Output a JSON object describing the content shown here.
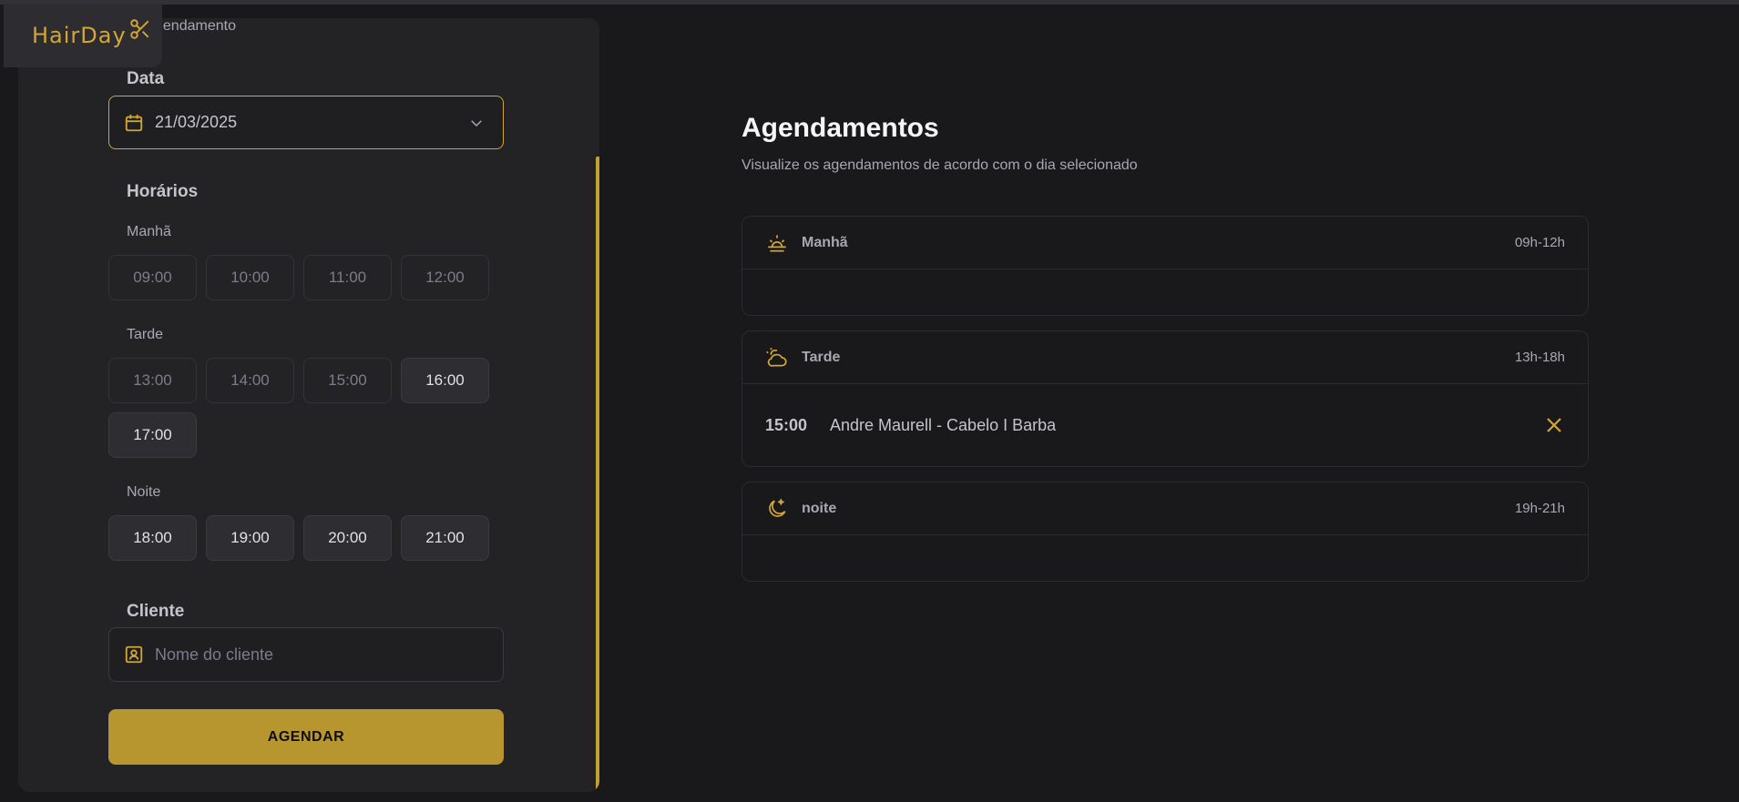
{
  "app": {
    "logo_text": "HairDay"
  },
  "form": {
    "subtitle_fragment": "gendamento",
    "date_label": "Data",
    "date_value": "21/03/2025",
    "times_label": "Horários",
    "groups": [
      {
        "label": "Manhã",
        "slots": [
          {
            "time": "09:00",
            "available": false
          },
          {
            "time": "10:00",
            "available": false
          },
          {
            "time": "11:00",
            "available": false
          },
          {
            "time": "12:00",
            "available": false
          }
        ]
      },
      {
        "label": "Tarde",
        "slots": [
          {
            "time": "13:00",
            "available": false
          },
          {
            "time": "14:00",
            "available": false
          },
          {
            "time": "15:00",
            "available": false
          },
          {
            "time": "16:00",
            "available": true
          },
          {
            "time": "17:00",
            "available": true
          }
        ]
      },
      {
        "label": "Noite",
        "slots": [
          {
            "time": "18:00",
            "available": true
          },
          {
            "time": "19:00",
            "available": true
          },
          {
            "time": "20:00",
            "available": true
          },
          {
            "time": "21:00",
            "available": true
          }
        ]
      }
    ],
    "client_label": "Cliente",
    "client_placeholder": "Nome do cliente",
    "client_value": "",
    "submit_label": "AGENDAR"
  },
  "schedule": {
    "title": "Agendamentos",
    "subtitle": "Visualize os agendamentos de acordo com o dia selecionado",
    "periods": [
      {
        "name": "Manhã",
        "range": "09h-12h",
        "icon": "sunrise-icon",
        "appointments": []
      },
      {
        "name": "Tarde",
        "range": "13h-18h",
        "icon": "cloud-sun-icon",
        "appointments": [
          {
            "time": "15:00",
            "client": "Andre Maurell - Cabelo I Barba"
          }
        ]
      },
      {
        "name": "noite",
        "range": "19h-21h",
        "icon": "moon-stars-icon",
        "appointments": []
      }
    ]
  },
  "colors": {
    "accent": "#d2a636",
    "button": "#b8962f",
    "background": "#19191b",
    "panel": "#232326"
  }
}
